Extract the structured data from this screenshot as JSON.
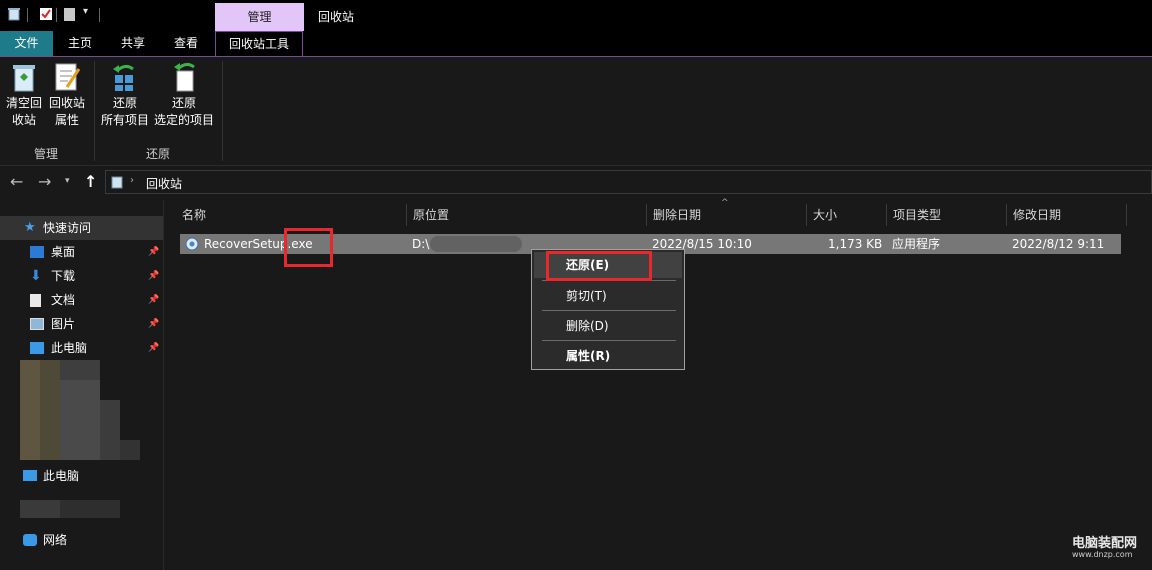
{
  "titlebar": {
    "context_tab": "管理",
    "window_title": "回收站"
  },
  "tabs": {
    "file": "文件",
    "home": "主页",
    "share": "共享",
    "view": "查看",
    "recycle_tools": "回收站工具"
  },
  "ribbon": {
    "empty_bin_line1": "清空回",
    "empty_bin_line2": "收站",
    "props_line1": "回收站",
    "props_line2": "属性",
    "restore_all_line1": "还原",
    "restore_all_line2": "所有项目",
    "restore_sel_line1": "还原",
    "restore_sel_line2": "选定的项目",
    "group_manage": "管理",
    "group_restore": "还原"
  },
  "address": {
    "path": "回收站"
  },
  "nav": {
    "quick_access": "快速访问",
    "desktop": "桌面",
    "downloads": "下载",
    "documents": "文档",
    "pictures": "图片",
    "this_pc_pinned": "此电脑",
    "this_pc": "此电脑",
    "network": "网络"
  },
  "columns": {
    "name": "名称",
    "original_location": "原位置",
    "date_deleted": "删除日期",
    "size": "大小",
    "item_type": "项目类型",
    "date_modified": "修改日期"
  },
  "file": {
    "name": "RecoverSetup.exe",
    "name_part1": "RecoverSetup",
    "name_part2": ".exe",
    "location": "D:\\",
    "date_deleted": "2022/8/15 10:10",
    "size": "1,173 KB",
    "type": "应用程序",
    "date_modified": "2022/8/12 9:11"
  },
  "context_menu": {
    "restore": "还原(E)",
    "cut": "剪切(T)",
    "delete": "删除(D)",
    "properties": "属性(R)"
  },
  "watermark": {
    "line1": "电脑装配网",
    "line2": "www.dnzp.com"
  },
  "colors": {
    "file_tab": "#1e7c8a",
    "context_tab": "#e2c6f7",
    "highlight": "#e8282c"
  }
}
